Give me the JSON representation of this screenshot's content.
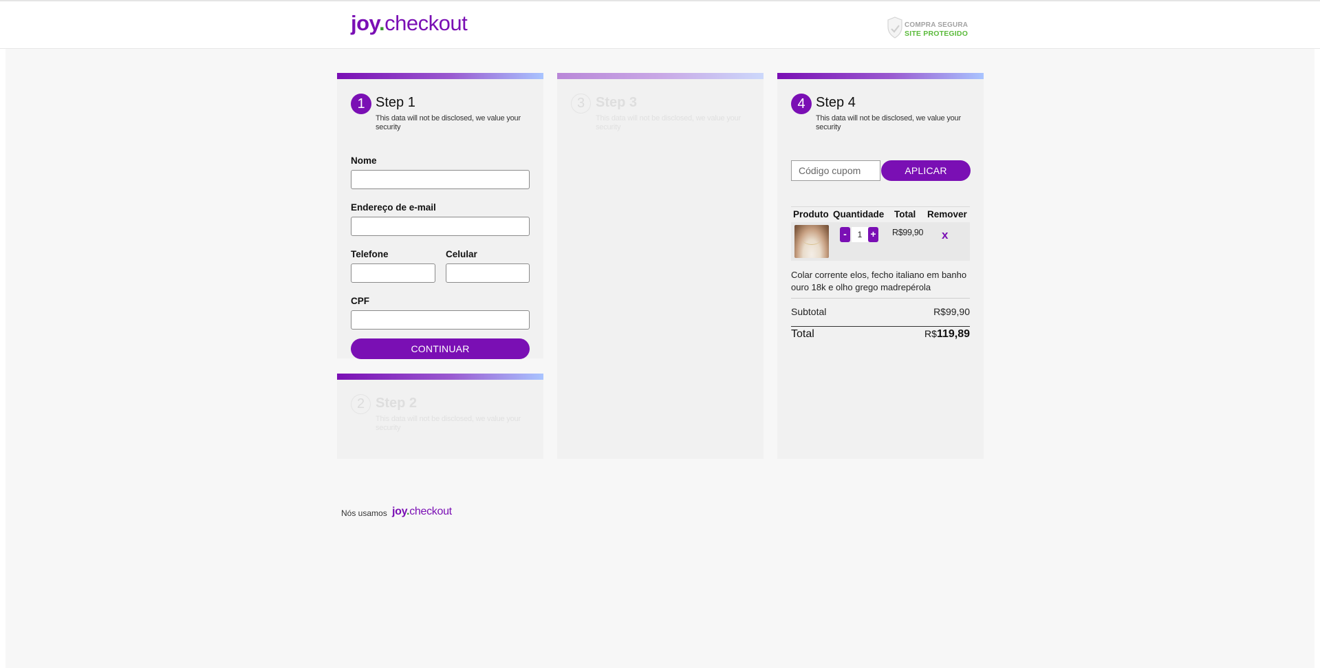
{
  "brand": {
    "logo_joy": "joy",
    "logo_dot": ".",
    "logo_checkout": "checkout",
    "primary_color": "#7a0fb4"
  },
  "security_badge": {
    "line1": "COMPRA SEGURA",
    "line2": "SITE PROTEGIDO",
    "icon": "shield-check-icon"
  },
  "step1": {
    "number": "1",
    "title": "Step 1",
    "subtitle": "This data will not be disclosed, we value your security",
    "fields": {
      "name_label": "Nome",
      "name_value": "",
      "email_label": "Endereço de e-mail",
      "email_value": "",
      "phone_label": "Telefone",
      "phone_value": "",
      "mobile_label": "Celular",
      "mobile_value": "",
      "cpf_label": "CPF",
      "cpf_value": ""
    },
    "continue_label": "CONTINUAR"
  },
  "step2": {
    "number": "2",
    "title": "Step 2",
    "subtitle": "This data will not be disclosed, we value your security"
  },
  "step3": {
    "number": "3",
    "title": "Step 3",
    "subtitle": "This data will not be disclosed, we value your security"
  },
  "step4": {
    "number": "4",
    "title": "Step 4",
    "subtitle": "This data will not be disclosed, we value your security",
    "coupon": {
      "placeholder": "Código cupom",
      "value": "",
      "apply_label": "APLICAR"
    },
    "table": {
      "headers": [
        "Produto",
        "Quantidade",
        "Total",
        "Remover"
      ],
      "rows": [
        {
          "quantity": "1",
          "minus": "-",
          "plus": "+",
          "total": "R$99,90",
          "remove": "x"
        }
      ]
    },
    "product_description": "Colar corrente elos, fecho italiano em banho ouro 18k e olho grego madrepérola",
    "subtotal_label": "Subtotal",
    "subtotal_value": "R$99,90",
    "total_label": "Total",
    "total_currency": "R$",
    "total_amount": "119,89"
  },
  "footer": {
    "text": "Nós usamos",
    "logo_joy": "joy",
    "logo_dot": ".",
    "logo_checkout": "checkout"
  }
}
